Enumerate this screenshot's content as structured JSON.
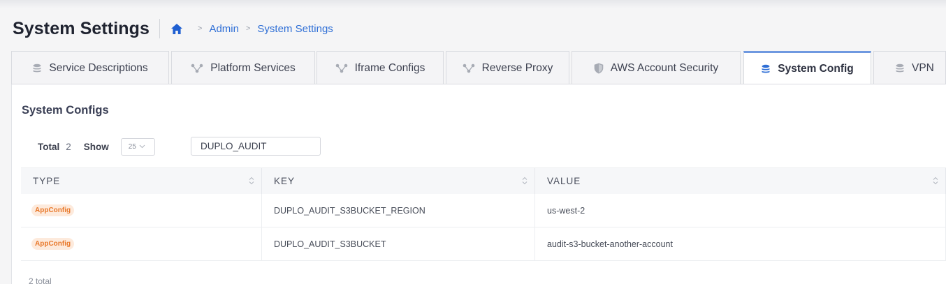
{
  "header": {
    "title": "System Settings",
    "breadcrumb": [
      "Admin",
      "System Settings"
    ]
  },
  "tabs": [
    {
      "label": "Service Descriptions",
      "icon": "database-icon",
      "active": false
    },
    {
      "label": "Platform Services",
      "icon": "network-nodes-icon",
      "active": false
    },
    {
      "label": "Iframe Configs",
      "icon": "network-nodes-icon",
      "active": false
    },
    {
      "label": "Reverse Proxy",
      "icon": "network-nodes-icon",
      "active": false
    },
    {
      "label": "AWS Account Security",
      "icon": "shield-icon",
      "active": false
    },
    {
      "label": "System Config",
      "icon": "database-icon",
      "active": true
    },
    {
      "label": "VPN",
      "icon": "database-icon",
      "active": false
    }
  ],
  "panel": {
    "title": "System Configs",
    "total_label": "Total",
    "total_value": "2",
    "show_label": "Show",
    "page_size": "25",
    "search_value": "DUPLO_AUDIT"
  },
  "table": {
    "columns": [
      "TYPE",
      "KEY",
      "VALUE"
    ],
    "rows": [
      {
        "type": "AppConfig",
        "key": "DUPLO_AUDIT_S3BUCKET_REGION",
        "value": "us-west-2"
      },
      {
        "type": "AppConfig",
        "key": "DUPLO_AUDIT_S3BUCKET",
        "value": "audit-s3-bucket-another-account"
      }
    ],
    "footer": "2 total"
  },
  "colors": {
    "accent": "#2f6fd6",
    "active_tab_border": "#6f99e0",
    "badge_text": "#e8782a",
    "badge_bg": "#fdeadc"
  }
}
